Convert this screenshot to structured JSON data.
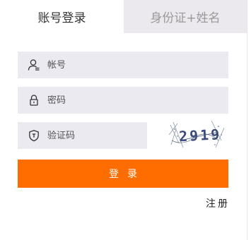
{
  "tabs": {
    "account_login": "账号登录",
    "id_name_login": "身份证+姓名"
  },
  "form": {
    "account_placeholder": "帐号",
    "password_placeholder": "密码",
    "captcha_placeholder": "验证码",
    "captcha_text": "2919",
    "login_label": "登录",
    "register_label": "注册"
  },
  "colors": {
    "primary": "#ff6d00",
    "field_bg": "#ebeaf0",
    "inactive_tab_bg": "#ebe9ee"
  },
  "icons": {
    "account": "user-icon",
    "password": "lock-icon",
    "captcha": "shield-icon"
  }
}
